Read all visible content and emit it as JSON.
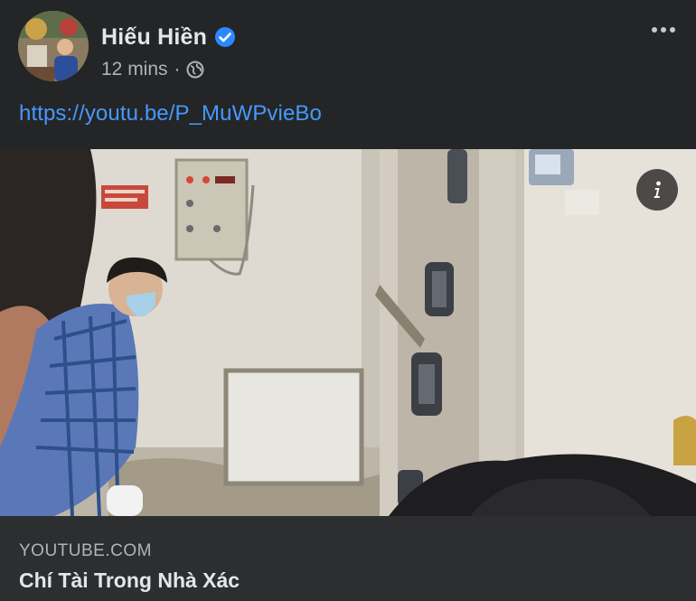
{
  "post": {
    "author": "Hiếu Hiền",
    "timestamp": "12 mins",
    "separator": "·",
    "privacy_icon": "globe-icon",
    "verified_icon": "verified-badge-icon",
    "more_icon": "more-options-icon",
    "text": "https://youtu.be/P_MuWPvieBo"
  },
  "link_preview": {
    "domain": "YOUTUBE.COM",
    "title": "Chí Tài Trong Nhà Xác",
    "info_icon": "info-icon"
  },
  "colors": {
    "background": "#242526",
    "card": "#2d2e30",
    "link": "#4599ff",
    "verified": "#2d88ff",
    "secondary_text": "#b0b3b8"
  }
}
